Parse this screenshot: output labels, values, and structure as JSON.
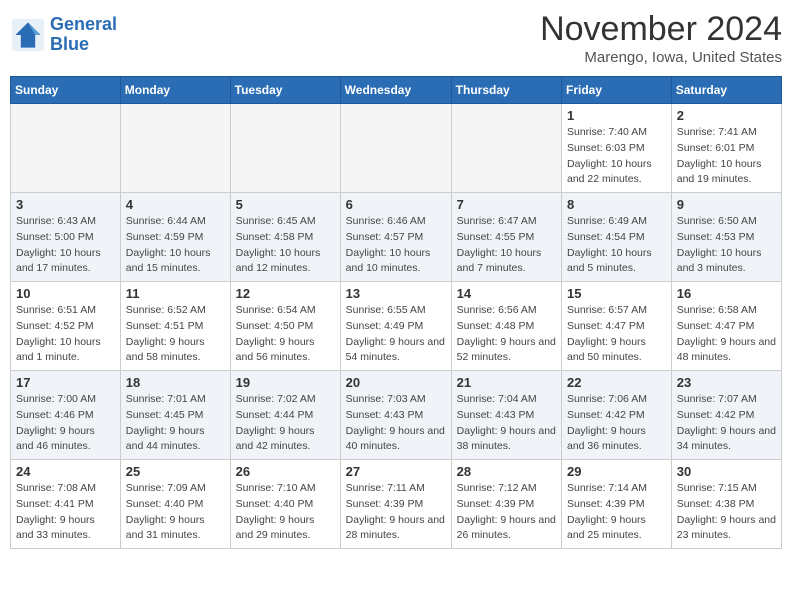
{
  "logo": {
    "line1": "General",
    "line2": "Blue"
  },
  "title": "November 2024",
  "subtitle": "Marengo, Iowa, United States",
  "days_of_week": [
    "Sunday",
    "Monday",
    "Tuesday",
    "Wednesday",
    "Thursday",
    "Friday",
    "Saturday"
  ],
  "weeks": [
    [
      {
        "day": "",
        "info": ""
      },
      {
        "day": "",
        "info": ""
      },
      {
        "day": "",
        "info": ""
      },
      {
        "day": "",
        "info": ""
      },
      {
        "day": "",
        "info": ""
      },
      {
        "day": "1",
        "info": "Sunrise: 7:40 AM\nSunset: 6:03 PM\nDaylight: 10 hours and 22 minutes."
      },
      {
        "day": "2",
        "info": "Sunrise: 7:41 AM\nSunset: 6:01 PM\nDaylight: 10 hours and 19 minutes."
      }
    ],
    [
      {
        "day": "3",
        "info": "Sunrise: 6:43 AM\nSunset: 5:00 PM\nDaylight: 10 hours and 17 minutes."
      },
      {
        "day": "4",
        "info": "Sunrise: 6:44 AM\nSunset: 4:59 PM\nDaylight: 10 hours and 15 minutes."
      },
      {
        "day": "5",
        "info": "Sunrise: 6:45 AM\nSunset: 4:58 PM\nDaylight: 10 hours and 12 minutes."
      },
      {
        "day": "6",
        "info": "Sunrise: 6:46 AM\nSunset: 4:57 PM\nDaylight: 10 hours and 10 minutes."
      },
      {
        "day": "7",
        "info": "Sunrise: 6:47 AM\nSunset: 4:55 PM\nDaylight: 10 hours and 7 minutes."
      },
      {
        "day": "8",
        "info": "Sunrise: 6:49 AM\nSunset: 4:54 PM\nDaylight: 10 hours and 5 minutes."
      },
      {
        "day": "9",
        "info": "Sunrise: 6:50 AM\nSunset: 4:53 PM\nDaylight: 10 hours and 3 minutes."
      }
    ],
    [
      {
        "day": "10",
        "info": "Sunrise: 6:51 AM\nSunset: 4:52 PM\nDaylight: 10 hours and 1 minute."
      },
      {
        "day": "11",
        "info": "Sunrise: 6:52 AM\nSunset: 4:51 PM\nDaylight: 9 hours and 58 minutes."
      },
      {
        "day": "12",
        "info": "Sunrise: 6:54 AM\nSunset: 4:50 PM\nDaylight: 9 hours and 56 minutes."
      },
      {
        "day": "13",
        "info": "Sunrise: 6:55 AM\nSunset: 4:49 PM\nDaylight: 9 hours and 54 minutes."
      },
      {
        "day": "14",
        "info": "Sunrise: 6:56 AM\nSunset: 4:48 PM\nDaylight: 9 hours and 52 minutes."
      },
      {
        "day": "15",
        "info": "Sunrise: 6:57 AM\nSunset: 4:47 PM\nDaylight: 9 hours and 50 minutes."
      },
      {
        "day": "16",
        "info": "Sunrise: 6:58 AM\nSunset: 4:47 PM\nDaylight: 9 hours and 48 minutes."
      }
    ],
    [
      {
        "day": "17",
        "info": "Sunrise: 7:00 AM\nSunset: 4:46 PM\nDaylight: 9 hours and 46 minutes."
      },
      {
        "day": "18",
        "info": "Sunrise: 7:01 AM\nSunset: 4:45 PM\nDaylight: 9 hours and 44 minutes."
      },
      {
        "day": "19",
        "info": "Sunrise: 7:02 AM\nSunset: 4:44 PM\nDaylight: 9 hours and 42 minutes."
      },
      {
        "day": "20",
        "info": "Sunrise: 7:03 AM\nSunset: 4:43 PM\nDaylight: 9 hours and 40 minutes."
      },
      {
        "day": "21",
        "info": "Sunrise: 7:04 AM\nSunset: 4:43 PM\nDaylight: 9 hours and 38 minutes."
      },
      {
        "day": "22",
        "info": "Sunrise: 7:06 AM\nSunset: 4:42 PM\nDaylight: 9 hours and 36 minutes."
      },
      {
        "day": "23",
        "info": "Sunrise: 7:07 AM\nSunset: 4:42 PM\nDaylight: 9 hours and 34 minutes."
      }
    ],
    [
      {
        "day": "24",
        "info": "Sunrise: 7:08 AM\nSunset: 4:41 PM\nDaylight: 9 hours and 33 minutes."
      },
      {
        "day": "25",
        "info": "Sunrise: 7:09 AM\nSunset: 4:40 PM\nDaylight: 9 hours and 31 minutes."
      },
      {
        "day": "26",
        "info": "Sunrise: 7:10 AM\nSunset: 4:40 PM\nDaylight: 9 hours and 29 minutes."
      },
      {
        "day": "27",
        "info": "Sunrise: 7:11 AM\nSunset: 4:39 PM\nDaylight: 9 hours and 28 minutes."
      },
      {
        "day": "28",
        "info": "Sunrise: 7:12 AM\nSunset: 4:39 PM\nDaylight: 9 hours and 26 minutes."
      },
      {
        "day": "29",
        "info": "Sunrise: 7:14 AM\nSunset: 4:39 PM\nDaylight: 9 hours and 25 minutes."
      },
      {
        "day": "30",
        "info": "Sunrise: 7:15 AM\nSunset: 4:38 PM\nDaylight: 9 hours and 23 minutes."
      }
    ]
  ]
}
